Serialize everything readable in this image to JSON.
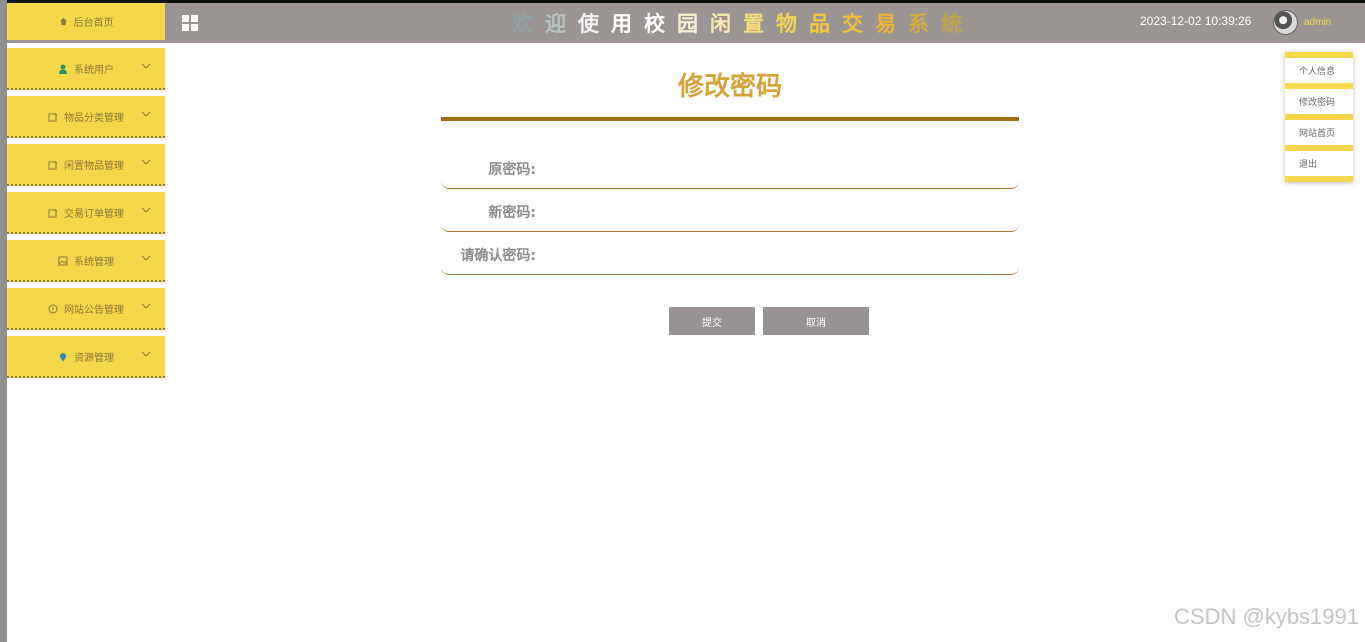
{
  "header": {
    "home_tab": "后台首页",
    "title_chars": [
      "欢",
      "迎",
      "使",
      "用",
      "校",
      "园",
      "闲",
      "置",
      "物",
      "品",
      "交",
      "易",
      "系",
      "统"
    ],
    "title_colors": [
      "#8ea3a8",
      "#b6c3c4",
      "#f2f2f2",
      "#ffffff",
      "#ffffff",
      "#f7f0cf",
      "#f7eab0",
      "#f5de79",
      "#f3d356",
      "#f1c93a",
      "#eebf36",
      "#e8b535",
      "#d6ab43",
      "#bfa250"
    ],
    "datetime": "2023-12-02 10:39:26",
    "username": "admin"
  },
  "sidebar": {
    "items": [
      {
        "label": "系统用户",
        "icon": "user-icon"
      },
      {
        "label": "物品分类管理",
        "icon": "note-edit-icon"
      },
      {
        "label": "闲置物品管理",
        "icon": "note-edit-icon"
      },
      {
        "label": "交易订单管理",
        "icon": "note-edit-icon"
      },
      {
        "label": "系统管理",
        "icon": "picture-icon"
      },
      {
        "label": "网站公告管理",
        "icon": "info-icon"
      },
      {
        "label": "资源管理",
        "icon": "location-icon"
      }
    ]
  },
  "form": {
    "title": "修改密码",
    "old_password_label": "原密码:",
    "new_password_label": "新密码:",
    "confirm_password_label": "请确认密码:",
    "old_password_value": "",
    "new_password_value": "",
    "confirm_password_value": "",
    "submit_label": "提交",
    "cancel_label": "取消"
  },
  "user_menu": {
    "items": [
      "个人信息",
      "修改密码",
      "网站首页",
      "退出"
    ]
  },
  "watermark": "CSDN @kybs1991",
  "colors": {
    "accent": "#f5d84a",
    "header_bg": "#9a9593",
    "title_gold": "#d6a23a",
    "rule": "#9a6f10"
  }
}
